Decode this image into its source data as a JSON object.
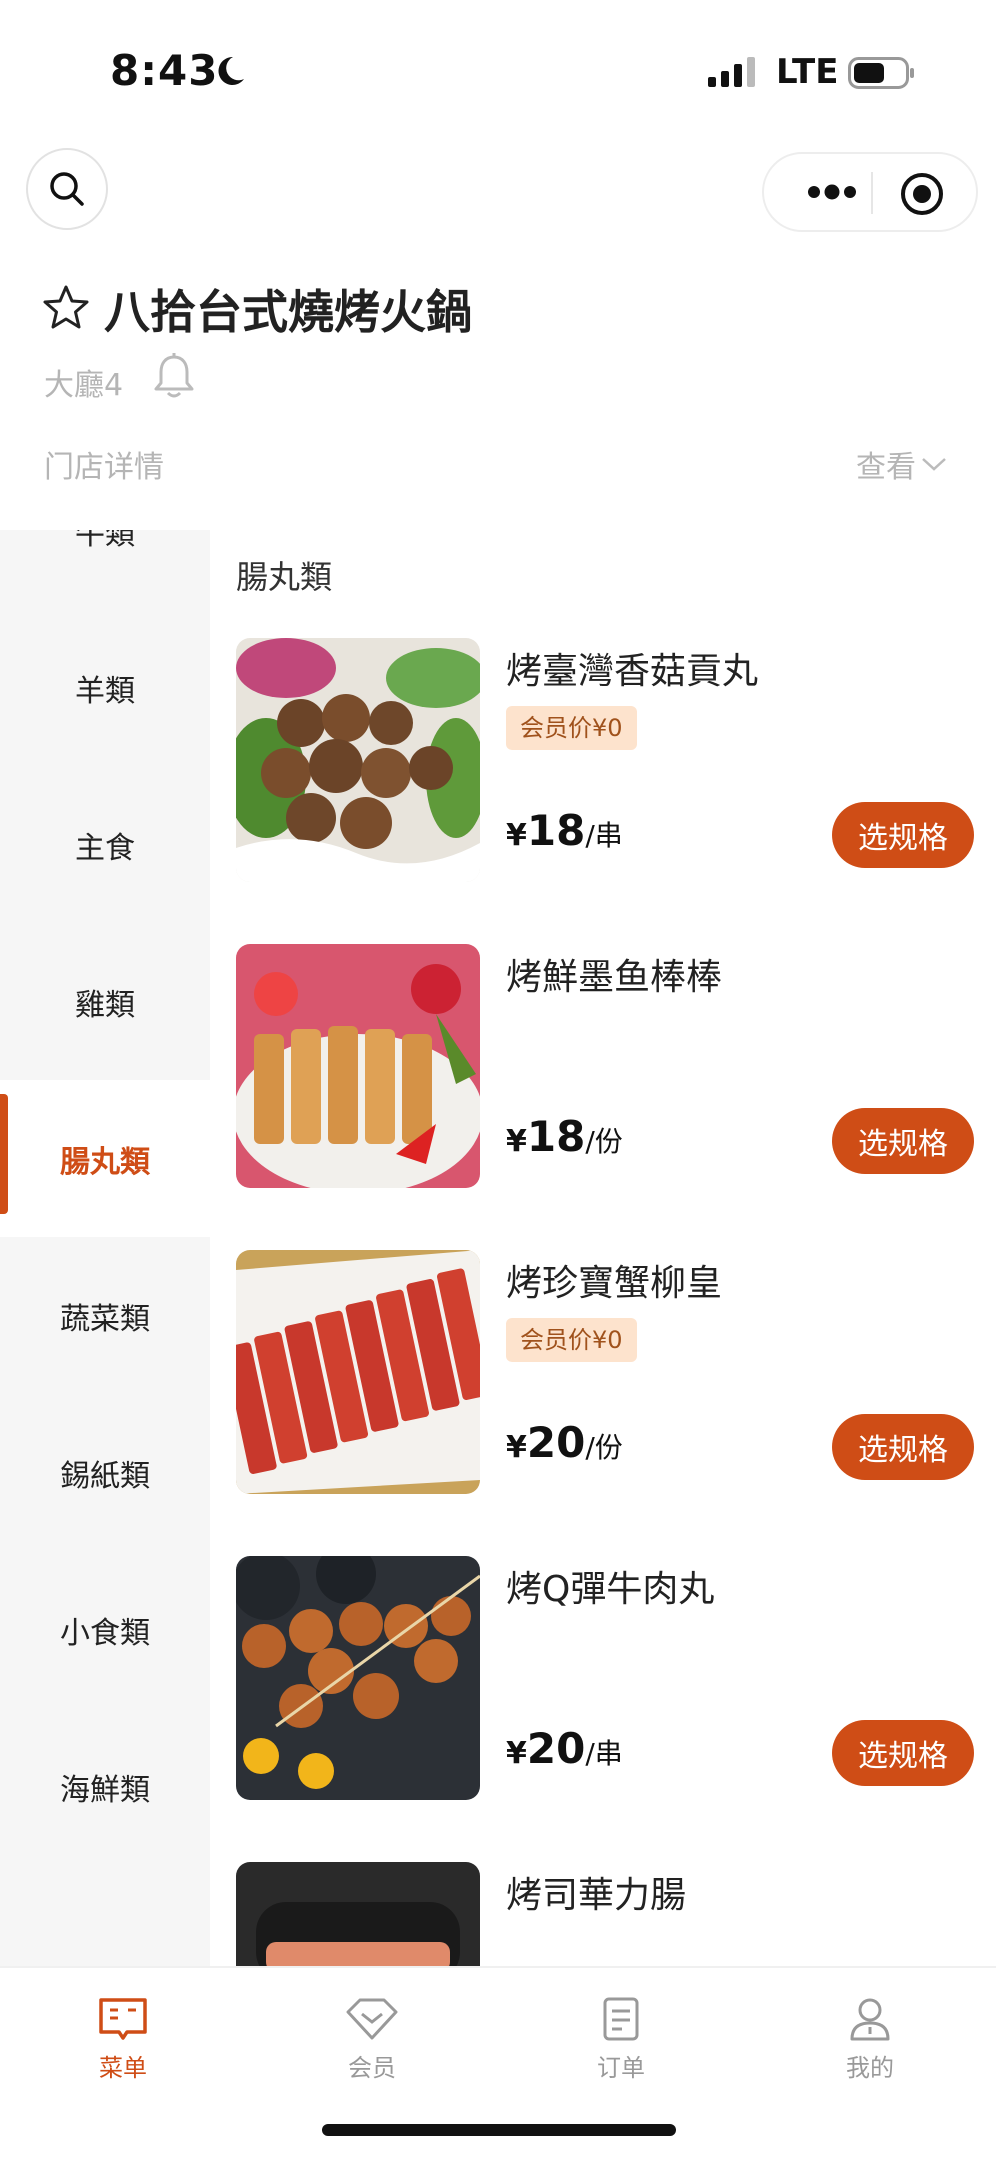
{
  "status_bar": {
    "time": "8:43",
    "network": "LTE"
  },
  "store": {
    "name": "八拾台式燒烤火鍋",
    "table": "大廳4",
    "detail_label": "门店详情",
    "view_label": "查看"
  },
  "categories": [
    {
      "label": "牛類"
    },
    {
      "label": "羊類"
    },
    {
      "label": "主食"
    },
    {
      "label": "雞類"
    },
    {
      "label": "腸丸類",
      "active": true
    },
    {
      "label": "蔬菜類"
    },
    {
      "label": "錫紙類"
    },
    {
      "label": "小食類"
    },
    {
      "label": "海鮮類"
    }
  ],
  "section": {
    "title": "腸丸類"
  },
  "dishes": [
    {
      "name": "烤臺灣香菇貢丸",
      "tag": "会员价¥0",
      "currency": "¥",
      "price": "18",
      "unit": "/串",
      "button": "选规格"
    },
    {
      "name": "烤鮮墨鱼棒棒",
      "tag": "",
      "currency": "¥",
      "price": "18",
      "unit": "/份",
      "button": "选规格"
    },
    {
      "name": "烤珍寶蟹柳皇",
      "tag": "会员价¥0",
      "currency": "¥",
      "price": "20",
      "unit": "/份",
      "button": "选规格"
    },
    {
      "name": "烤Q彈牛肉丸",
      "tag": "",
      "currency": "¥",
      "price": "20",
      "unit": "/串",
      "button": "选规格"
    },
    {
      "name": "烤司華力腸"
    }
  ],
  "tabs": [
    {
      "label": "菜单",
      "icon": "menu-book-icon",
      "active": true
    },
    {
      "label": "会员",
      "icon": "member-diamond-icon"
    },
    {
      "label": "订单",
      "icon": "order-document-icon"
    },
    {
      "label": "我的",
      "icon": "profile-person-icon"
    }
  ],
  "colors": {
    "accent": "#cf4d16",
    "tag_bg": "#fde3cd",
    "tag_text": "#a0521c",
    "sidebar_bg": "#f6f6f6"
  }
}
